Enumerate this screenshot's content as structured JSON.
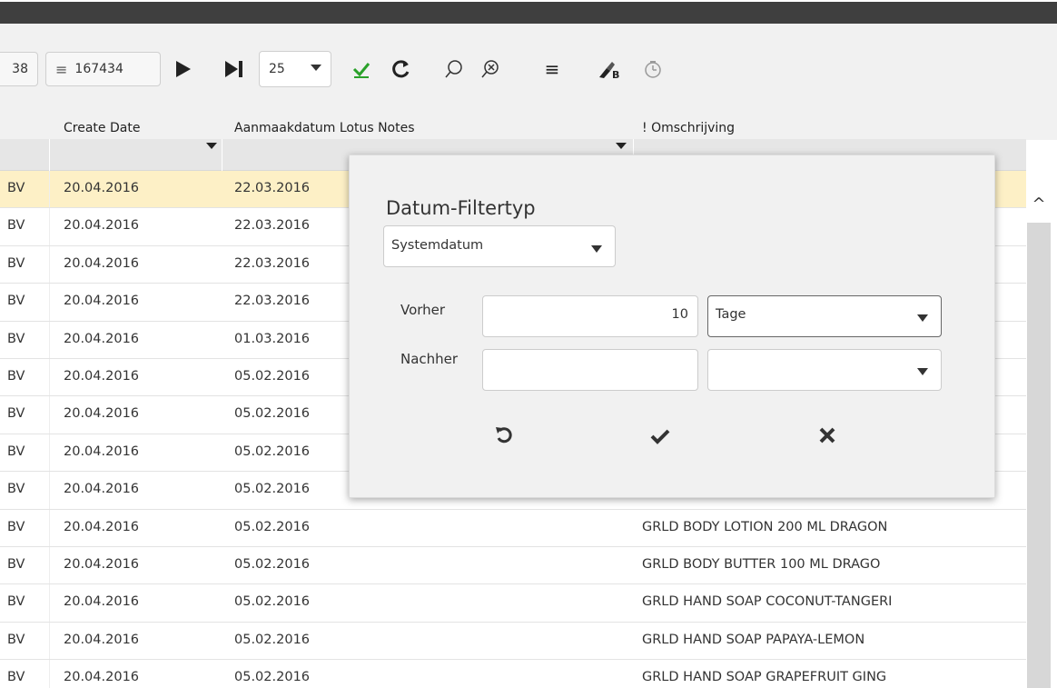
{
  "window": {
    "title_fragment": ""
  },
  "toolbar": {
    "page_fragment": "38",
    "record_count": "167434",
    "page_size": "25",
    "icons": [
      "lines-icon",
      "play-icon",
      "last-page-icon",
      "check-icon",
      "refresh-icon",
      "search-icon",
      "clear-search-icon",
      "list-icon",
      "brush-b-icon",
      "history-icon"
    ]
  },
  "columns": {
    "create_date": "Create Date",
    "lotus_date": "Aanmaakdatum Lotus Notes",
    "omschrijving": "! Omschrijving"
  },
  "rows": [
    {
      "bv": "BV",
      "create": "20.04.2016",
      "lotus": "22.03.2016",
      "omsch": "",
      "selected": true
    },
    {
      "bv": "BV",
      "create": "20.04.2016",
      "lotus": "22.03.2016",
      "omsch": ""
    },
    {
      "bv": "BV",
      "create": "20.04.2016",
      "lotus": "22.03.2016",
      "omsch": ""
    },
    {
      "bv": "BV",
      "create": "20.04.2016",
      "lotus": "22.03.2016",
      "omsch": ""
    },
    {
      "bv": "BV",
      "create": "20.04.2016",
      "lotus": "01.03.2016",
      "omsch": ""
    },
    {
      "bv": "BV",
      "create": "20.04.2016",
      "lotus": "05.02.2016",
      "omsch": ""
    },
    {
      "bv": "BV",
      "create": "20.04.2016",
      "lotus": "05.02.2016",
      "omsch": ""
    },
    {
      "bv": "BV",
      "create": "20.04.2016",
      "lotus": "05.02.2016",
      "omsch": ""
    },
    {
      "bv": "BV",
      "create": "20.04.2016",
      "lotus": "05.02.2016",
      "omsch": ""
    },
    {
      "bv": "BV",
      "create": "20.04.2016",
      "lotus": "05.02.2016",
      "omsch": "GRLD BODY LOTION 200 ML DRAGON"
    },
    {
      "bv": "BV",
      "create": "20.04.2016",
      "lotus": "05.02.2016",
      "omsch": "GRLD BODY BUTTER 100 ML DRAGO"
    },
    {
      "bv": "BV",
      "create": "20.04.2016",
      "lotus": "05.02.2016",
      "omsch": "GRLD HAND SOAP COCONUT-TANGERI"
    },
    {
      "bv": "BV",
      "create": "20.04.2016",
      "lotus": "05.02.2016",
      "omsch": "GRLD HAND SOAP PAPAYA-LEMON"
    },
    {
      "bv": "BV",
      "create": "20.04.2016",
      "lotus": "05.02.2016",
      "omsch": "GRLD HAND SOAP GRAPEFRUIT GING"
    }
  ],
  "popup": {
    "title": "Datum-Filtertyp",
    "type_value": "Systemdatum",
    "before_label": "Vorher",
    "before_value": "10",
    "before_unit": "Tage",
    "after_label": "Nachher",
    "after_value": "",
    "after_unit": ""
  },
  "colors": {
    "selected_row": "#fdf0c6",
    "check_green": "#2aa12a",
    "titlebar": "#3f3f3f"
  }
}
